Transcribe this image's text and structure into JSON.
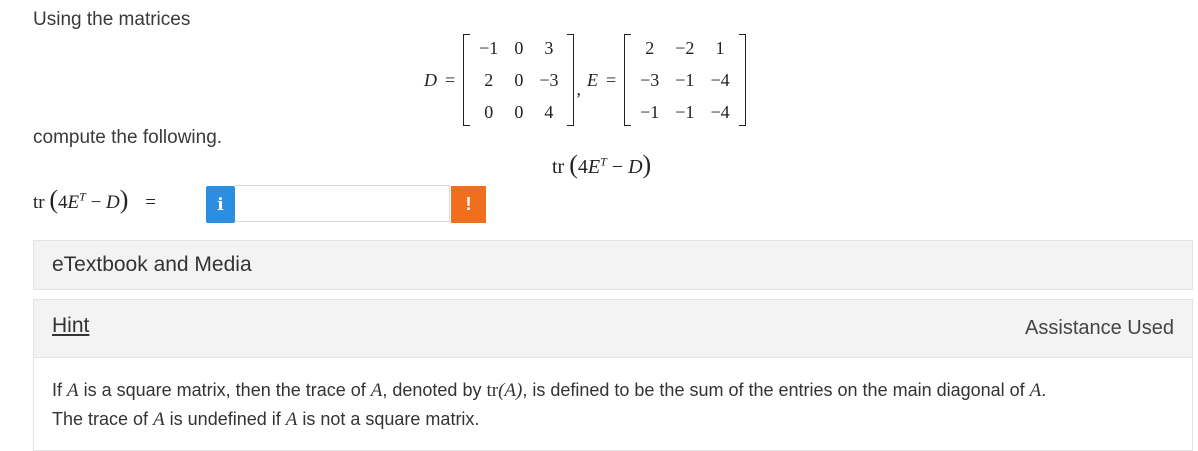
{
  "intro_text": "Using the matrices",
  "compute_text": "compute the following.",
  "matrix_D": {
    "label": "D",
    "rows": [
      [
        "−1",
        "0",
        "3"
      ],
      [
        "2",
        "0",
        "−3"
      ],
      [
        "0",
        "0",
        "4"
      ]
    ]
  },
  "matrix_E": {
    "label": "E",
    "rows": [
      [
        "2",
        "−2",
        "1"
      ],
      [
        "−3",
        "−1",
        "−4"
      ],
      [
        "−1",
        "−1",
        "−4"
      ]
    ]
  },
  "equals": "=",
  "comma": ",",
  "expression": {
    "tr": "tr",
    "open": "(",
    "coef": "4",
    "E": "E",
    "T": "T",
    "minus": " − ",
    "D": "D",
    "close": ")"
  },
  "answer": {
    "info_icon": "i",
    "value": "",
    "placeholder": "",
    "warning_icon": "!"
  },
  "etextbook_label": "eTextbook and Media",
  "hint": {
    "link_label": "Hint",
    "assistance": "Assistance Used",
    "line1": {
      "t1": "If ",
      "A1": "A",
      "t2": " is a square matrix, then the trace of ",
      "A2": "A",
      "t3": ", denoted by ",
      "tr": "tr",
      "A3": "(A)",
      "t4": ", is defined to be the sum of the entries on the main diagonal of ",
      "A4": "A",
      "t5": "."
    },
    "line2": {
      "t1": "The trace of ",
      "A1": "A",
      "t2": " is undefined if ",
      "A2": "A",
      "t3": " is not a square matrix."
    }
  },
  "colors": {
    "info_button": "#2b8ee0",
    "warning_button": "#f06f1e",
    "panel_bg": "#f3f3f3"
  }
}
